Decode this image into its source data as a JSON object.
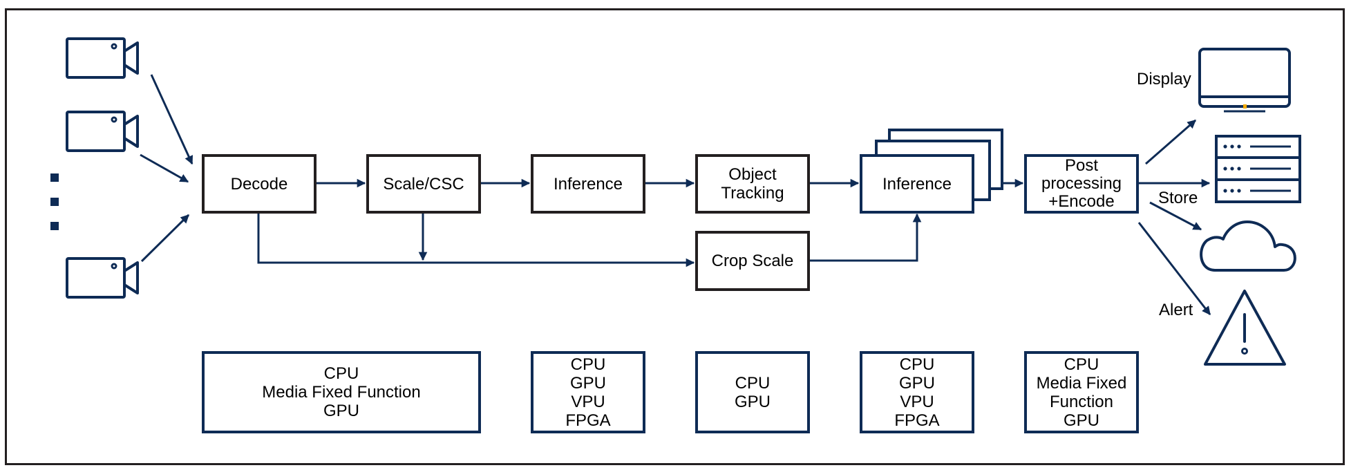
{
  "colors": {
    "navy": "#0e2b55",
    "frame": "#231f20",
    "indicator": "#f2a900"
  },
  "inputs": {
    "camera_count_shown": 3,
    "icon": "video-camera-icon",
    "ellipsis": "vertical-ellipsis"
  },
  "pipeline": {
    "decode": {
      "lines": [
        "Decode"
      ]
    },
    "scale_csc": {
      "lines": [
        "Scale/CSC"
      ]
    },
    "inference": {
      "lines": [
        "Inference"
      ]
    },
    "object_tracking": {
      "lines": [
        "Object",
        "Tracking"
      ]
    },
    "crop_scale": {
      "lines": [
        "Crop Scale"
      ]
    },
    "inference_multi": {
      "lines": [
        "Inference"
      ]
    },
    "post_processing": {
      "lines": [
        "Post",
        "processing",
        "+Encode"
      ]
    }
  },
  "hardware": {
    "decode_scale": {
      "lines": [
        "CPU",
        "Media Fixed Function",
        "GPU"
      ]
    },
    "inference": {
      "lines": [
        "CPU",
        "GPU",
        "VPU",
        "FPGA"
      ]
    },
    "object_tracking": {
      "lines": [
        "CPU",
        "GPU"
      ]
    },
    "inference_multi": {
      "lines": [
        "CPU",
        "GPU",
        "VPU",
        "FPGA"
      ]
    },
    "post_processing": {
      "lines": [
        "CPU",
        "Media Fixed",
        "Function",
        "GPU"
      ]
    }
  },
  "outputs": {
    "display": {
      "label": "Display",
      "icon": "monitor-icon"
    },
    "store": {
      "label": "Store",
      "icons": [
        "server-icon",
        "cloud-icon"
      ]
    },
    "alert": {
      "label": "Alert",
      "icon": "warning-icon"
    }
  }
}
